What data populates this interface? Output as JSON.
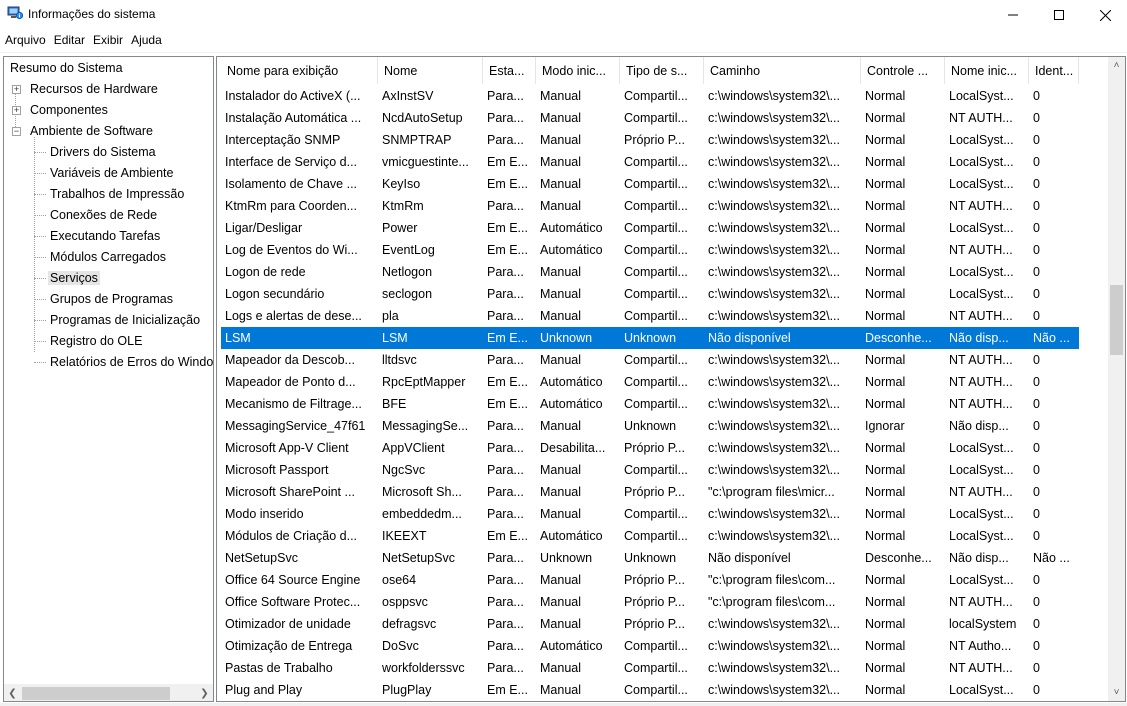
{
  "window": {
    "title": "Informações do sistema",
    "icon": "computer-info-icon",
    "minimize_icon": "minimize-icon",
    "maximize_icon": "maximize-icon",
    "close_icon": "close-icon"
  },
  "menu": [
    "Arquivo",
    "Editar",
    "Exibir",
    "Ajuda"
  ],
  "tree": {
    "items": [
      {
        "label": "Resumo do Sistema",
        "level": 0,
        "expander": ""
      },
      {
        "label": "Recursos de Hardware",
        "level": 1,
        "expander": "+"
      },
      {
        "label": "Componentes",
        "level": 1,
        "expander": "+"
      },
      {
        "label": "Ambiente de Software",
        "level": 1,
        "expander": "−"
      },
      {
        "label": "Drivers do Sistema",
        "level": 2,
        "expander": ""
      },
      {
        "label": "Variáveis de Ambiente",
        "level": 2,
        "expander": ""
      },
      {
        "label": "Trabalhos de Impressão",
        "level": 2,
        "expander": ""
      },
      {
        "label": "Conexões de Rede",
        "level": 2,
        "expander": ""
      },
      {
        "label": "Executando Tarefas",
        "level": 2,
        "expander": ""
      },
      {
        "label": "Módulos Carregados",
        "level": 2,
        "expander": ""
      },
      {
        "label": "Serviços",
        "level": 2,
        "expander": "",
        "selected": true
      },
      {
        "label": "Grupos de Programas",
        "level": 2,
        "expander": ""
      },
      {
        "label": "Programas de Inicialização",
        "level": 2,
        "expander": ""
      },
      {
        "label": "Registro do OLE",
        "level": 2,
        "expander": ""
      },
      {
        "label": "Relatórios de Erros do Windows",
        "level": 2,
        "expander": ""
      }
    ],
    "scroll_left_icon": "chevron-left-icon",
    "scroll_right_icon": "chevron-right-icon"
  },
  "list": {
    "columns": [
      "Nome para exibição",
      "Nome",
      "Esta...",
      "Modo inic...",
      "Tipo de s...",
      "Caminho",
      "Controle ...",
      "Nome inic...",
      "Ident..."
    ],
    "selected_index": 11,
    "rows": [
      [
        "Instalador do ActiveX (...",
        "AxInstSV",
        "Para...",
        "Manual",
        "Compartil...",
        "c:\\windows\\system32\\...",
        "Normal",
        "LocalSyst...",
        "0"
      ],
      [
        "Instalação Automática ...",
        "NcdAutoSetup",
        "Para...",
        "Manual",
        "Compartil...",
        "c:\\windows\\system32\\...",
        "Normal",
        "NT AUTH...",
        "0"
      ],
      [
        "Interceptação SNMP",
        "SNMPTRAP",
        "Para...",
        "Manual",
        "Próprio P...",
        "c:\\windows\\system32\\...",
        "Normal",
        "LocalSyst...",
        "0"
      ],
      [
        "Interface de Serviço d...",
        "vmicguestinte...",
        "Em E...",
        "Manual",
        "Compartil...",
        "c:\\windows\\system32\\...",
        "Normal",
        "LocalSyst...",
        "0"
      ],
      [
        "Isolamento de Chave ...",
        "KeyIso",
        "Em E...",
        "Manual",
        "Compartil...",
        "c:\\windows\\system32\\...",
        "Normal",
        "LocalSyst...",
        "0"
      ],
      [
        "KtmRm para Coorden...",
        "KtmRm",
        "Para...",
        "Manual",
        "Compartil...",
        "c:\\windows\\system32\\...",
        "Normal",
        "NT AUTH...",
        "0"
      ],
      [
        "Ligar/Desligar",
        "Power",
        "Em E...",
        "Automático",
        "Compartil...",
        "c:\\windows\\system32\\...",
        "Normal",
        "LocalSyst...",
        "0"
      ],
      [
        "Log de Eventos do Wi...",
        "EventLog",
        "Em E...",
        "Automático",
        "Compartil...",
        "c:\\windows\\system32\\...",
        "Normal",
        "NT AUTH...",
        "0"
      ],
      [
        "Logon de rede",
        "Netlogon",
        "Para...",
        "Manual",
        "Compartil...",
        "c:\\windows\\system32\\...",
        "Normal",
        "LocalSyst...",
        "0"
      ],
      [
        "Logon secundário",
        "seclogon",
        "Para...",
        "Manual",
        "Compartil...",
        "c:\\windows\\system32\\...",
        "Normal",
        "LocalSyst...",
        "0"
      ],
      [
        "Logs e alertas de dese...",
        "pla",
        "Para...",
        "Manual",
        "Compartil...",
        "c:\\windows\\system32\\...",
        "Normal",
        "NT AUTH...",
        "0"
      ],
      [
        "LSM",
        "LSM",
        "Em E...",
        "Unknown",
        "Unknown",
        "Não disponível",
        "Desconhe...",
        "Não disp...",
        "Não ..."
      ],
      [
        "Mapeador da Descob...",
        "lltdsvc",
        "Para...",
        "Manual",
        "Compartil...",
        "c:\\windows\\system32\\...",
        "Normal",
        "NT AUTH...",
        "0"
      ],
      [
        "Mapeador de Ponto d...",
        "RpcEptMapper",
        "Em E...",
        "Automático",
        "Compartil...",
        "c:\\windows\\system32\\...",
        "Normal",
        "NT AUTH...",
        "0"
      ],
      [
        "Mecanismo de Filtrage...",
        "BFE",
        "Em E...",
        "Automático",
        "Compartil...",
        "c:\\windows\\system32\\...",
        "Normal",
        "NT AUTH...",
        "0"
      ],
      [
        "MessagingService_47f61",
        "MessagingSe...",
        "Para...",
        "Manual",
        "Unknown",
        "c:\\windows\\system32\\...",
        "Ignorar",
        "Não disp...",
        "0"
      ],
      [
        "Microsoft App-V Client",
        "AppVClient",
        "Para...",
        "Desabilita...",
        "Próprio P...",
        "c:\\windows\\system32\\...",
        "Normal",
        "LocalSyst...",
        "0"
      ],
      [
        "Microsoft Passport",
        "NgcSvc",
        "Para...",
        "Manual",
        "Compartil...",
        "c:\\windows\\system32\\...",
        "Normal",
        "LocalSyst...",
        "0"
      ],
      [
        "Microsoft SharePoint ...",
        "Microsoft Sh...",
        "Para...",
        "Manual",
        "Próprio P...",
        "\"c:\\program files\\micr...",
        "Normal",
        "NT AUTH...",
        "0"
      ],
      [
        "Modo inserido",
        "embeddedm...",
        "Para...",
        "Manual",
        "Compartil...",
        "c:\\windows\\system32\\...",
        "Normal",
        "LocalSyst...",
        "0"
      ],
      [
        "Módulos de Criação d...",
        "IKEEXT",
        "Em E...",
        "Automático",
        "Compartil...",
        "c:\\windows\\system32\\...",
        "Normal",
        "LocalSyst...",
        "0"
      ],
      [
        "NetSetupSvc",
        "NetSetupSvc",
        "Para...",
        "Unknown",
        "Unknown",
        "Não disponível",
        "Desconhe...",
        "Não disp...",
        "Não ..."
      ],
      [
        "Office 64 Source Engine",
        "ose64",
        "Para...",
        "Manual",
        "Próprio P...",
        "\"c:\\program files\\com...",
        "Normal",
        "LocalSyst...",
        "0"
      ],
      [
        "Office Software Protec...",
        "osppsvc",
        "Para...",
        "Manual",
        "Próprio P...",
        "\"c:\\program files\\com...",
        "Normal",
        "NT AUTH...",
        "0"
      ],
      [
        "Otimizador de unidade",
        "defragsvc",
        "Para...",
        "Manual",
        "Próprio P...",
        "c:\\windows\\system32\\...",
        "Normal",
        "localSystem",
        "0"
      ],
      [
        "Otimização de Entrega",
        "DoSvc",
        "Para...",
        "Automático",
        "Compartil...",
        "c:\\windows\\system32\\...",
        "Normal",
        "NT Autho...",
        "0"
      ],
      [
        "Pastas de Trabalho",
        "workfolderssvc",
        "Para...",
        "Manual",
        "Compartil...",
        "c:\\windows\\system32\\...",
        "Normal",
        "NT AUTH...",
        "0"
      ],
      [
        "Plug and Play",
        "PlugPlay",
        "Em E...",
        "Manual",
        "Compartil...",
        "c:\\windows\\system32\\...",
        "Normal",
        "LocalSyst...",
        "0"
      ]
    ],
    "scroll_up_icon": "chevron-up-icon",
    "scroll_down_icon": "chevron-down-icon"
  },
  "colors": {
    "selection": "#0078d7",
    "tree_selection": "#e5e5e5",
    "border": "#828790"
  }
}
